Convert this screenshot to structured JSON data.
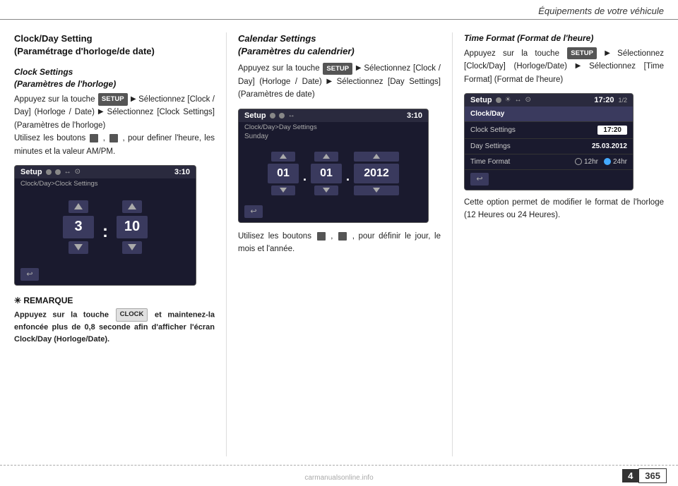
{
  "header": {
    "title": "Équipements de votre véhicule"
  },
  "left_col": {
    "main_heading": "Clock/Day Setting",
    "main_heading_sub": "(Paramétrage d'horloge/de date)",
    "sub_heading": "Clock Settings",
    "sub_heading_sub": "(Paramètres de l'horloge)",
    "body1": "Appuyez sur la touche",
    "btn_setup": "SETUP",
    "body2": "Sélectionnez [Clock / Day] (Horloge / Date)",
    "body3": "Sélectionnez [Clock Settings] (Paramètres de l'horloge)",
    "body4": "Utilisez les boutons",
    "body5": ", pour definer l'heure, les minutes et la valeur AM/PM.",
    "screen_title": "Setup",
    "screen_subtitle": "Clock/Day>Clock Settings",
    "screen_time": "3:10",
    "screen_val1": "3",
    "screen_val2": "10",
    "remarque_heading": "✳ REMARQUE",
    "remarque_body": "Appuyez sur la touche",
    "remarque_btn": "CLOCK",
    "remarque_body2": "et maintenez-la enfoncée plus de 0,8 seconde afin d'afficher l'écran Clock/Day (Horloge/Date)."
  },
  "mid_col": {
    "heading": "Calendar Settings",
    "heading_sub": "(Paramètres du calendrier)",
    "body1": "Appuyez sur la touche",
    "btn_setup": "SETUP",
    "body2": "Sélectionnez [Clock / Day] (Horloge / Date)",
    "body3": "Sélectionnez [Day Settings] (Paramètres de date)",
    "screen_title": "Setup",
    "screen_subtitle": "Clock/Day>Day Settings",
    "screen_time": "3:10",
    "day_label": "Sunday",
    "val_day1": "01",
    "val_day2": "01",
    "val_year": "2012",
    "body4": "Utilisez les boutons",
    "body5": ", pour définir le jour, le mois et l'année."
  },
  "right_col": {
    "heading": "Time Format (Format de l'heure)",
    "body1": "Appuyez sur la touche",
    "btn_setup": "SETUP",
    "body2": "Sélectionnez [Clock/Day] (Horloge/Date)",
    "body3": "Sélectionnez [Time Format] (Format de l'heure)",
    "screen_title": "Setup",
    "screen_subtitle_icons": "⚙ ☀ ←→",
    "screen_time": "17:20",
    "screen_page": "1/2",
    "screen_row1_label": "Clock/Day",
    "screen_row2_label": "Clock Settings",
    "screen_row2_value": "17:20",
    "screen_row3_label": "Day Settings",
    "screen_row3_value": "25.03.2012",
    "screen_row4_label": "Time Format",
    "screen_radio1": "12hr",
    "screen_radio2": "24hr",
    "body4": "Cette option permet de modifier le format de l'horloge (12 Heures ou 24 Heures)."
  },
  "footer": {
    "page_left": "4",
    "page_right": "365",
    "watermark": "carmanualsonline.info"
  }
}
